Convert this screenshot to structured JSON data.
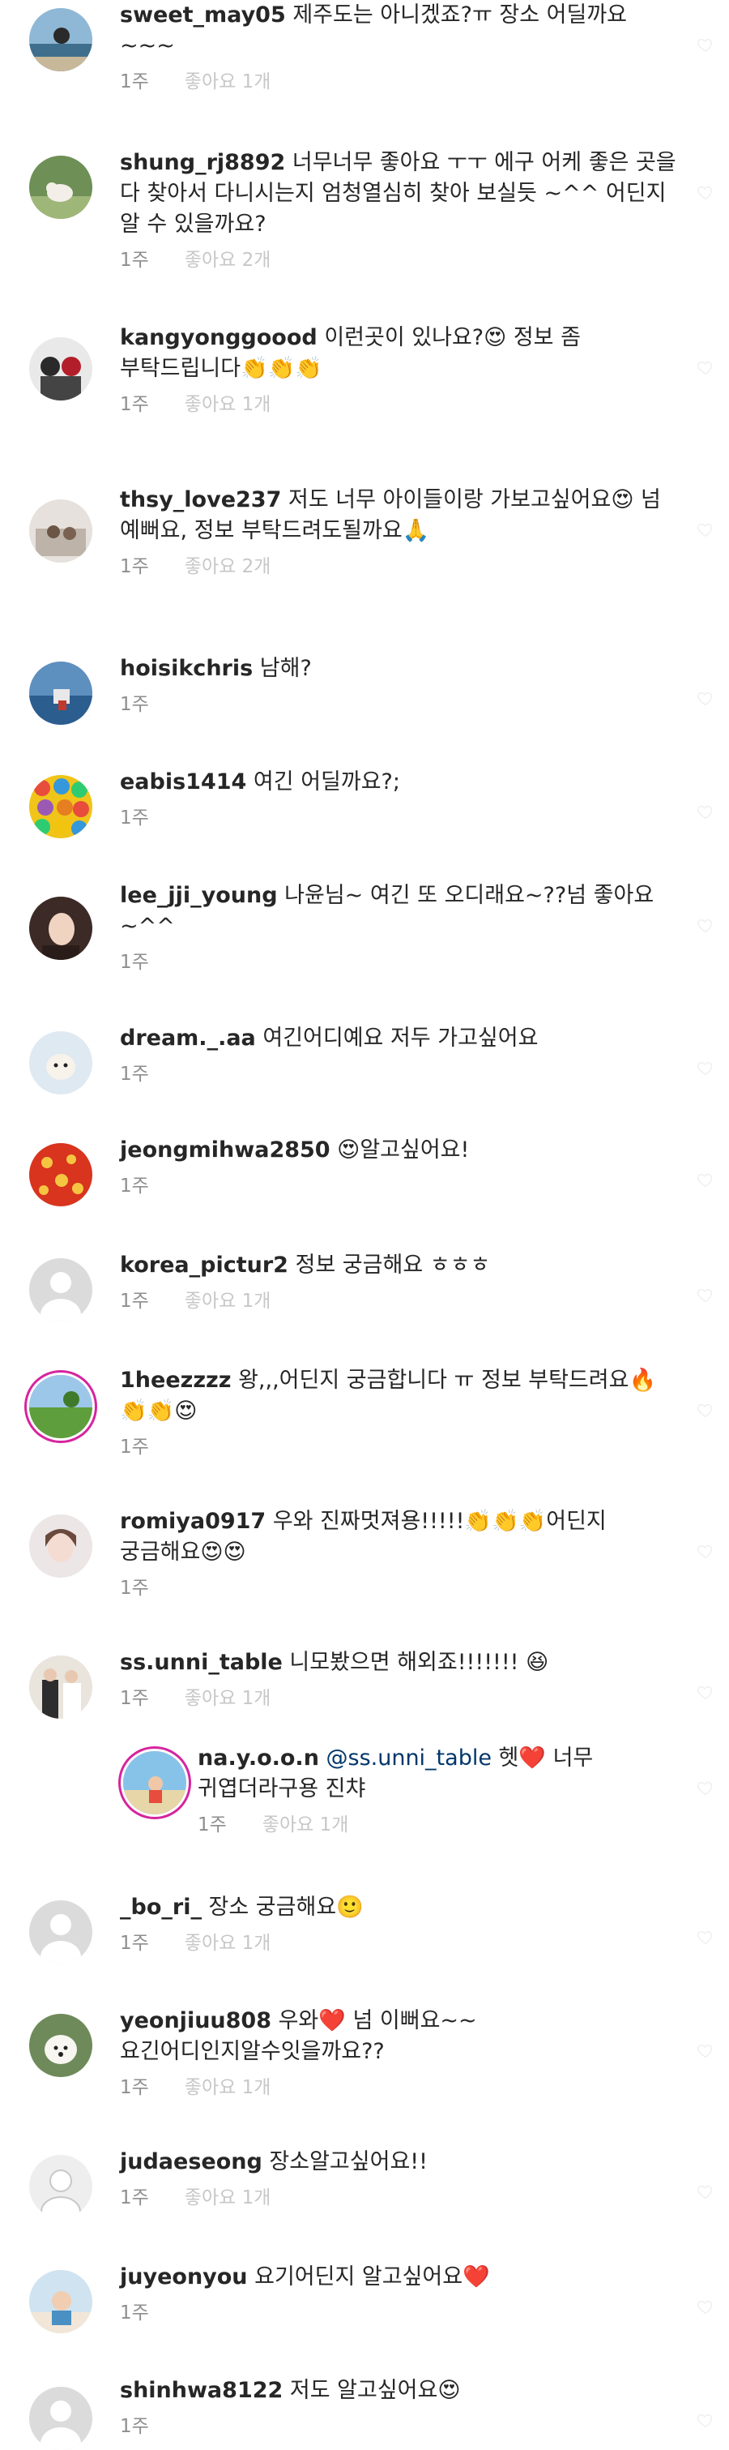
{
  "comments": [
    {
      "avatar": "beach-photo-avatar",
      "user": "sweet_may05",
      "text": " 제주도는 아니겠죠?ㅠ 장소 어딜까요~~~",
      "time": "1주",
      "likes": "좋아요 1개"
    },
    {
      "avatar": "dog-photo-avatar",
      "user": "shung_rj8892",
      "text": " 너무너무 좋아요 ㅜㅜ 에구 어케 좋은 곳을 다 찾아서 다니시는지 엄청열심히 찾아 보실듯 ~^^ 어딘지 알 수 있을까요?",
      "time": "1주",
      "likes": "좋아요 2개"
    },
    {
      "avatar": "group-photo-avatar",
      "user": "kangyonggoood",
      "text": " 이런곳이 있나요?😍 정보 좀 부탁드립니다👏👏👏",
      "time": "1주",
      "likes": "좋아요 1개"
    },
    {
      "avatar": "kids-photo-avatar",
      "user": "thsy_love237",
      "text": " 저도 너무 아이들이랑 가보고싶어요😍 넘 예뻐요, 정보 부탁드려도될까요🙏",
      "time": "1주",
      "likes": "좋아요 2개"
    },
    {
      "avatar": "harbor-photo-avatar",
      "user": "hoisikchris",
      "text": " 남해?",
      "time": "1주",
      "likes": ""
    },
    {
      "avatar": "colorful-balls-avatar",
      "user": "eabis1414",
      "text": " 여긴 어딜까요?;",
      "time": "1주",
      "likes": ""
    },
    {
      "avatar": "woman-portrait-avatar",
      "user": "lee_jji_young",
      "text": " 나윤님~ 여긴 또 오디래요~??넘 좋아요~^^",
      "time": "1주",
      "likes": ""
    },
    {
      "avatar": "puppy-photo-avatar",
      "user": "dream._.aa",
      "text": " 여긴어디예요  저두 가고싶어요",
      "time": "1주",
      "likes": ""
    },
    {
      "avatar": "red-pattern-avatar",
      "user": "jeongmihwa2850",
      "text": " 😍알고싶어요!",
      "time": "1주",
      "likes": ""
    },
    {
      "avatar": "default-avatar",
      "user": "korea_pictur2",
      "text": " 정보 궁금해요 ㅎㅎㅎ",
      "time": "1주",
      "likes": "좋아요 1개"
    },
    {
      "avatar": "field-photo-avatar",
      "user": "1heezzzz",
      "text": " 왕,,,어딘지 궁금합니다 ㅠ 정보 부탁드려요🔥👏👏😍",
      "time": "1주",
      "likes": "",
      "story_ring": true
    },
    {
      "avatar": "girl-portrait-avatar",
      "user": "romiya0917",
      "text": " 우와 진짜멋져용!!!!!👏👏👏어딘지 궁금해요😍😍",
      "time": "1주",
      "likes": ""
    },
    {
      "avatar": "wedding-photo-avatar",
      "user": "ss.unni_table",
      "text": " 니모봤으면 해외죠!!!!!!! 😆",
      "time": "1주",
      "likes": "좋아요 1개"
    },
    {
      "avatar": "beach-kid-avatar",
      "user": "na.y.o.o.n",
      "mention": " @ss.unni_table",
      "text": " 헷❤️ 너무 귀엽더라구용 진챠",
      "time": "1주",
      "likes": "좋아요 1개",
      "reply": true,
      "story_ring": true
    },
    {
      "avatar": "default-avatar",
      "user": "_bo_ri_",
      "text": " 장소 궁금해요🙂",
      "time": "1주",
      "likes": "좋아요 1개"
    },
    {
      "avatar": "white-dog-avatar",
      "user": "yeonjiuu808",
      "text": " 우와❤️ 넘 이뻐요~~요긴어디인지알수잇을까요??",
      "time": "1주",
      "likes": "좋아요 1개"
    },
    {
      "avatar": "silhouette-avatar",
      "user": "judaeseong",
      "text": " 장소알고싶어요!!",
      "time": "1주",
      "likes": "좋아요 1개"
    },
    {
      "avatar": "baby-photo-avatar",
      "user": "juyeonyou",
      "text": " 요기어딘지 알고싶어요❤️",
      "time": "1주",
      "likes": ""
    },
    {
      "avatar": "default-avatar",
      "user": "shinhwa8122",
      "text": " 저도 알고싶어요😍",
      "time": "1주",
      "likes": ""
    }
  ]
}
